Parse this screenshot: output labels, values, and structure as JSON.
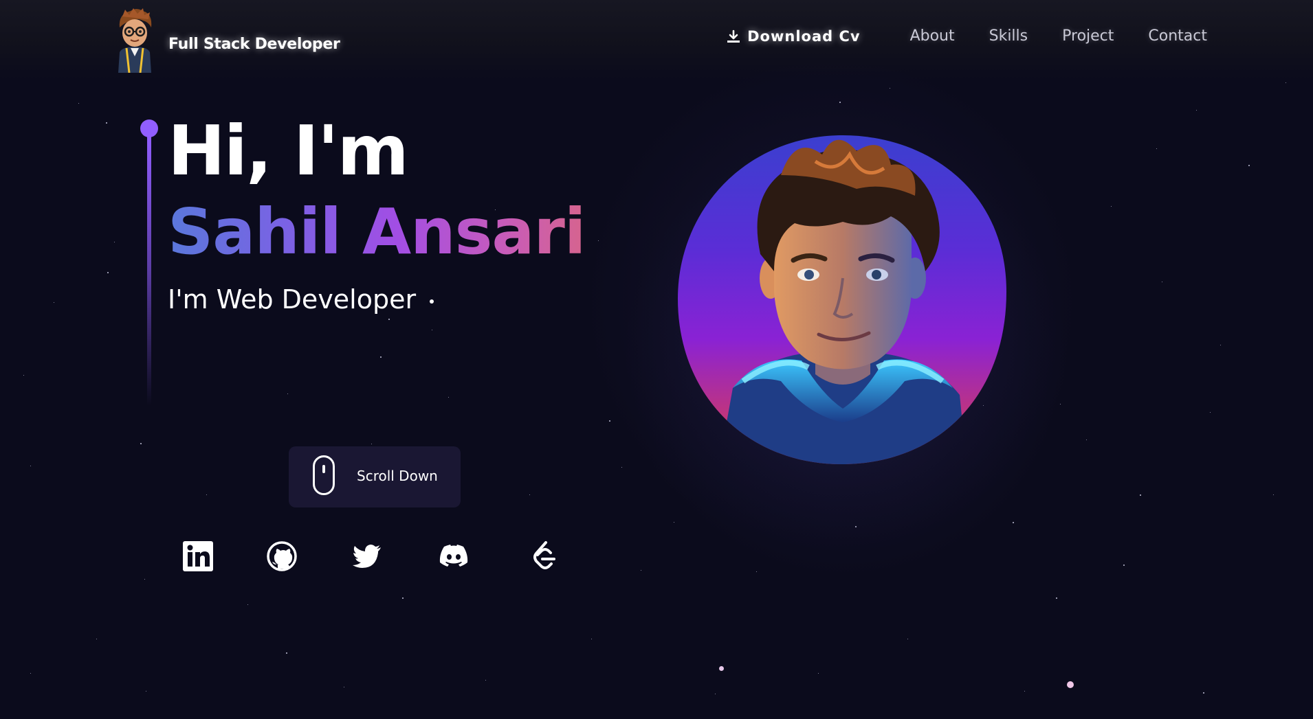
{
  "navbar": {
    "brand_name": "Full Stack Developer",
    "download_cv_label": "Download Cv",
    "links": [
      "About",
      "Skills",
      "Project",
      "Contact"
    ]
  },
  "hero": {
    "greeting": "Hi, I'm",
    "name": "Sahil Ansari",
    "role": "I'm Web Developer",
    "scroll_label": "Scroll Down"
  },
  "socials": [
    {
      "name": "linkedin",
      "icon": "linkedin-icon"
    },
    {
      "name": "github",
      "icon": "github-icon"
    },
    {
      "name": "twitter",
      "icon": "twitter-icon"
    },
    {
      "name": "discord",
      "icon": "discord-icon"
    },
    {
      "name": "leetcode",
      "icon": "leetcode-icon"
    }
  ],
  "colors": {
    "background": "#0b0b1c",
    "accent": "#915eff",
    "name_gradient": [
      "#5a78db",
      "#a24ee4",
      "#d6648e"
    ],
    "scroll_button_bg": "#1a1733",
    "nav_link": "#c9c9d6"
  }
}
